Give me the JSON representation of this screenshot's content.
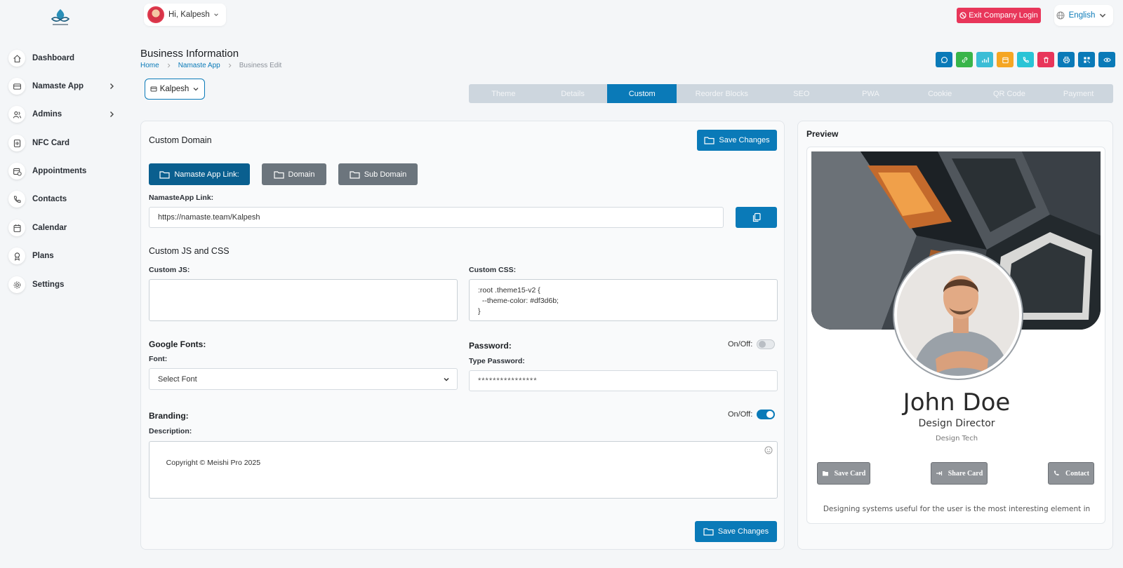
{
  "user": {
    "greeting": "Hi, Kalpesh"
  },
  "topbar": {
    "exit_label": "Exit Company Login",
    "language": "English"
  },
  "sidebar": {
    "items": [
      {
        "label": "Dashboard",
        "icon": "home-icon"
      },
      {
        "label": "Namaste App",
        "icon": "card-icon",
        "has_submenu": true
      },
      {
        "label": "Admins",
        "icon": "users-icon",
        "has_submenu": true
      },
      {
        "label": "NFC Card",
        "icon": "nfc-icon"
      },
      {
        "label": "Appointments",
        "icon": "calendar-clock-icon"
      },
      {
        "label": "Contacts",
        "icon": "phone-icon"
      },
      {
        "label": "Calendar",
        "icon": "calendar-icon"
      },
      {
        "label": "Plans",
        "icon": "award-icon"
      },
      {
        "label": "Settings",
        "icon": "gear-icon"
      }
    ]
  },
  "header": {
    "title": "Business Information",
    "breadcrumb": [
      "Home",
      "Namaste App",
      "Business Edit"
    ]
  },
  "actions": [
    {
      "icon": "whatsapp-icon",
      "color": "#0a7ab8"
    },
    {
      "icon": "link-icon",
      "color": "#39b54a"
    },
    {
      "icon": "analytics-icon",
      "color": "#3bbdd6"
    },
    {
      "icon": "calendar-icon",
      "color": "#f5a623"
    },
    {
      "icon": "phone-icon",
      "color": "#29c4d6"
    },
    {
      "icon": "trash-icon",
      "color": "#e8365a"
    },
    {
      "icon": "print-icon",
      "color": "#0a7ab8"
    },
    {
      "icon": "qr-icon",
      "color": "#0a7ab8"
    },
    {
      "icon": "eye-icon",
      "color": "#0a7ab8"
    }
  ],
  "company_select": "Kalpesh",
  "tabs": [
    {
      "label": "Theme",
      "active": false
    },
    {
      "label": "Details",
      "active": false
    },
    {
      "label": "Custom",
      "active": true
    },
    {
      "label": "Reorder Blocks",
      "active": false
    },
    {
      "label": "SEO",
      "active": false
    },
    {
      "label": "PWA",
      "active": false
    },
    {
      "label": "Cookie",
      "active": false
    },
    {
      "label": "QR Code",
      "active": false
    },
    {
      "label": "Payment",
      "active": false
    }
  ],
  "custom_domain": {
    "title": "Custom Domain",
    "save_label": "Save Changes",
    "link_buttons": [
      "Namaste App Link:",
      "Domain",
      "Sub Domain"
    ],
    "link_label": "NamasteApp Link:",
    "link_value": "https://namaste.team/Kalpesh"
  },
  "custom_code": {
    "title": "Custom JS and CSS",
    "js_label": "Custom JS:",
    "js_value": "",
    "css_label": "Custom CSS:",
    "css_value": ":root .theme15-v2 {\n  --theme-color: #df3d6b;\n}"
  },
  "fonts": {
    "title": "Google Fonts:",
    "font_label": "Font:",
    "font_value": "Select Font"
  },
  "password": {
    "title": "Password:",
    "toggle_label": "On/Off:",
    "enabled": false,
    "field_label": "Type Password:",
    "field_value": "****************"
  },
  "branding": {
    "title": "Branding:",
    "toggle_label": "On/Off:",
    "enabled": true,
    "desc_label": "Description:",
    "desc_value": "Copyright © Meishi Pro 2025"
  },
  "footer": {
    "save_label": "Save Changes"
  },
  "preview": {
    "title": "Preview",
    "name": "John Doe",
    "role": "Design Director",
    "company": "Design Tech",
    "buttons": [
      "Save Card",
      "Share Card",
      "Contact"
    ],
    "bio": "Designing systems useful for the user is the most interesting element in"
  }
}
